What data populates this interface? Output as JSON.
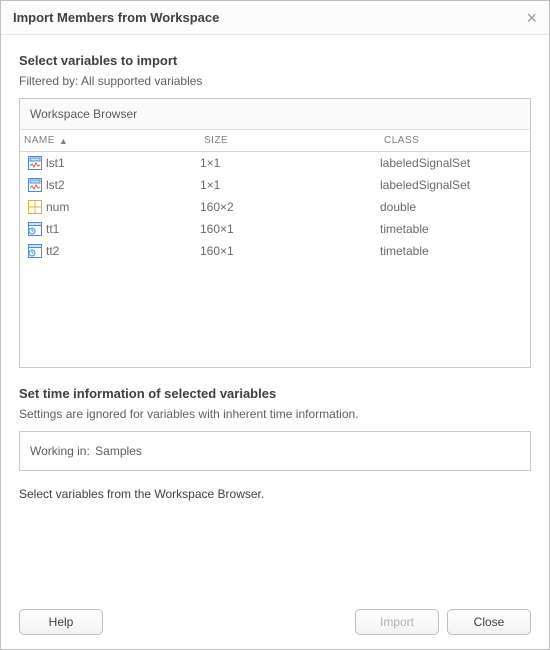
{
  "dialog": {
    "title": "Import Members from Workspace"
  },
  "select_section": {
    "heading": "Select variables to import",
    "filter_prefix": "Filtered by:",
    "filter_value": "All supported variables"
  },
  "workspace_browser": {
    "title": "Workspace Browser",
    "columns": {
      "name": "NAME",
      "size": "SIZE",
      "class": "CLASS"
    },
    "sort_column": "name",
    "sort_dir": "asc",
    "rows": [
      {
        "icon": "signalset-icon",
        "name": "lst1",
        "size": "1×1",
        "class": "labeledSignalSet"
      },
      {
        "icon": "signalset-icon",
        "name": "lst2",
        "size": "1×1",
        "class": "labeledSignalSet"
      },
      {
        "icon": "numeric-icon",
        "name": "num",
        "size": "160×2",
        "class": "double"
      },
      {
        "icon": "timetable-icon",
        "name": "tt1",
        "size": "160×1",
        "class": "timetable"
      },
      {
        "icon": "timetable-icon",
        "name": "tt2",
        "size": "160×1",
        "class": "timetable"
      }
    ]
  },
  "time_section": {
    "heading": "Set time information of selected variables",
    "note": "Settings are ignored for variables with inherent time information.",
    "working_in_label": "Working in:",
    "working_in_value": "Samples"
  },
  "hint": "Select variables from the Workspace Browser.",
  "buttons": {
    "help": "Help",
    "import": "Import",
    "close": "Close"
  }
}
